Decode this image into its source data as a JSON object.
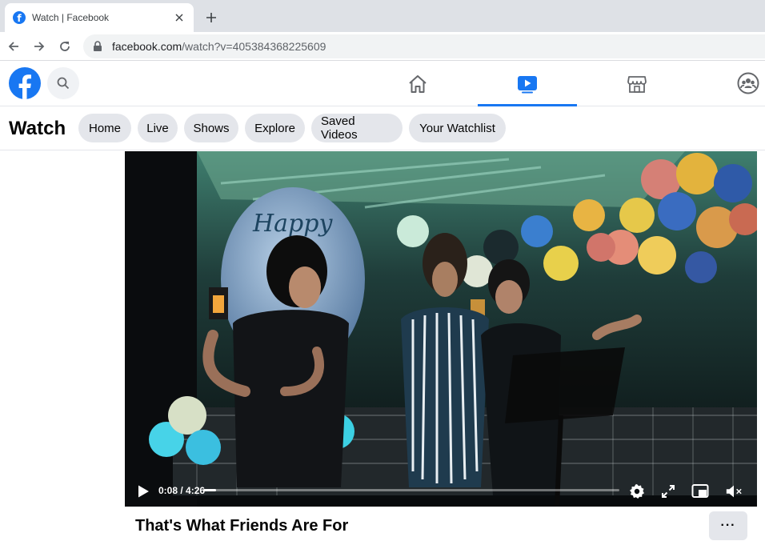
{
  "browser": {
    "tab": {
      "title": "Watch | Facebook",
      "favicon": "facebook-f-icon"
    },
    "new_tab_icon": "plus-icon",
    "nav": {
      "back_icon": "arrow-left-icon",
      "forward_icon": "arrow-right-icon",
      "reload_icon": "reload-icon"
    },
    "address": {
      "domain": "facebook.com",
      "path": "/watch?v=405384368225609",
      "lock_icon": "lock-icon"
    }
  },
  "fb_header": {
    "logo": "facebook-logo",
    "search_icon": "search-icon",
    "tabs": [
      {
        "name": "home",
        "icon": "home-icon",
        "active": false
      },
      {
        "name": "watch",
        "icon": "video-play-icon",
        "active": true
      },
      {
        "name": "marketplace",
        "icon": "store-icon",
        "active": false
      },
      {
        "name": "groups",
        "icon": "groups-icon",
        "active": false
      }
    ],
    "accent_color": "#1877f2"
  },
  "watch_nav": {
    "title": "Watch",
    "pills": [
      "Home",
      "Live",
      "Shows",
      "Explore",
      "Saved Videos",
      "Your Watchlist"
    ]
  },
  "video": {
    "time_display": "0:08 / 4:26",
    "progress_fraction": 0.03,
    "controls": [
      "play-icon",
      "settings-icon",
      "expand-icon",
      "picture-in-picture-icon",
      "muted-volume-icon"
    ],
    "scene_text": "Happy Birthday"
  },
  "title": "That's What Friends Are For",
  "more_label": "···"
}
